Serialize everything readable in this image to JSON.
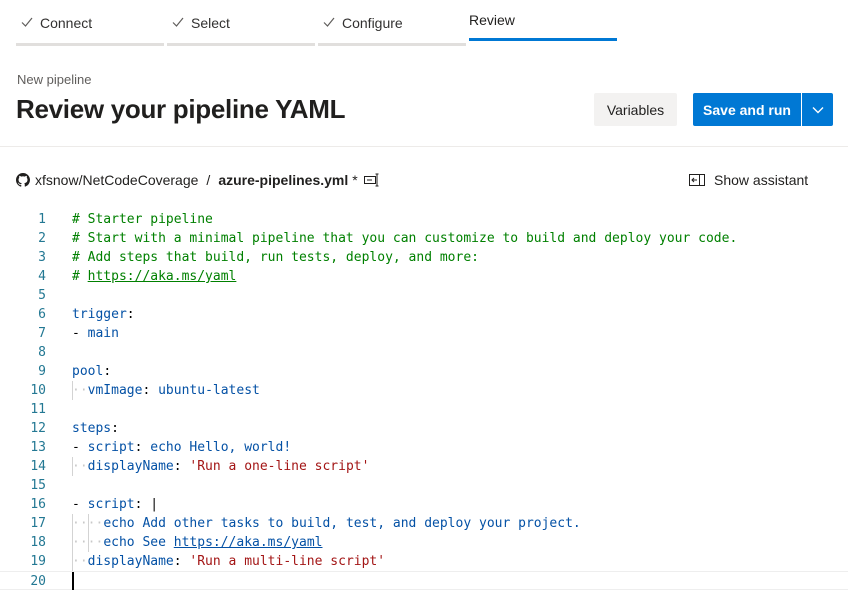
{
  "wizard": {
    "steps": [
      {
        "label": "Connect",
        "state": "done"
      },
      {
        "label": "Select",
        "state": "done"
      },
      {
        "label": "Configure",
        "state": "done"
      },
      {
        "label": "Review",
        "state": "active"
      }
    ]
  },
  "header": {
    "subtitle": "New pipeline",
    "title": "Review your pipeline YAML",
    "variables_label": "Variables",
    "save_run_label": "Save and run"
  },
  "file": {
    "repo": "xfsnow/NetCodeCoverage",
    "separator": "/",
    "filename": "azure-pipelines.yml",
    "modified_marker": "*",
    "show_assistant_label": "Show assistant"
  },
  "editor": {
    "lines": [
      {
        "n": "1",
        "text": "# Starter pipeline"
      },
      {
        "n": "2",
        "text": "# Start with a minimal pipeline that you can customize to build and deploy your code."
      },
      {
        "n": "3",
        "text": "# Add steps that build, run tests, deploy, and more:"
      },
      {
        "n": "4",
        "text": "# https://aka.ms/yaml"
      },
      {
        "n": "5",
        "text": ""
      },
      {
        "n": "6",
        "text": "trigger:"
      },
      {
        "n": "7",
        "text": "- main"
      },
      {
        "n": "8",
        "text": ""
      },
      {
        "n": "9",
        "text": "pool:"
      },
      {
        "n": "10",
        "text": "  vmImage: ubuntu-latest"
      },
      {
        "n": "11",
        "text": ""
      },
      {
        "n": "12",
        "text": "steps:"
      },
      {
        "n": "13",
        "text": "- script: echo Hello, world!"
      },
      {
        "n": "14",
        "text": "  displayName: 'Run a one-line script'"
      },
      {
        "n": "15",
        "text": ""
      },
      {
        "n": "16",
        "text": "- script: |"
      },
      {
        "n": "17",
        "text": "    echo Add other tasks to build, test, and deploy your project."
      },
      {
        "n": "18",
        "text": "    echo See https://aka.ms/yaml"
      },
      {
        "n": "19",
        "text": "  displayName: 'Run a multi-line script'"
      },
      {
        "n": "20",
        "text": ""
      }
    ]
  },
  "colors": {
    "accent": "#0078d4",
    "comment": "#008000",
    "key": "#0451a5",
    "string": "#a31515",
    "line_number": "#237893"
  }
}
